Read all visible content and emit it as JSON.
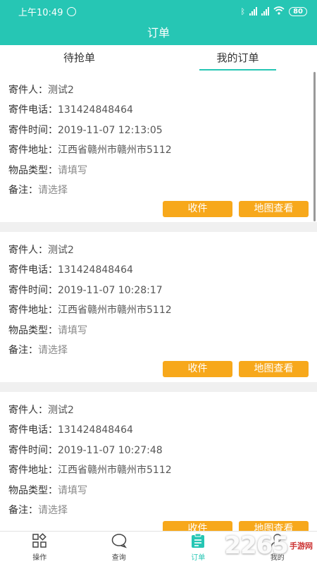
{
  "status_bar": {
    "time": "上午10:49",
    "battery": "80"
  },
  "header": {
    "title": "订单"
  },
  "tabs": [
    {
      "label": "待抢单",
      "active": false
    },
    {
      "label": "我的订单",
      "active": true
    }
  ],
  "field_labels": {
    "sender": "寄件人：",
    "phone": "寄件电话：",
    "time": "寄件时间：",
    "address": "寄件地址：",
    "type": "物品类型：",
    "remark": "备注："
  },
  "orders": [
    {
      "sender": "测试2",
      "phone": "131424848464",
      "time": "2019-11-07 12:13:05",
      "address": "江西省赣州市赣州市5112",
      "type": "请填写",
      "remark": "请选择"
    },
    {
      "sender": "测试2",
      "phone": "131424848464",
      "time": "2019-11-07 10:28:17",
      "address": "江西省赣州市赣州市5112",
      "type": "请填写",
      "remark": "请选择"
    },
    {
      "sender": "测试2",
      "phone": "131424848464",
      "time": "2019-11-07 10:27:48",
      "address": "江西省赣州市赣州市5112",
      "type": "请填写",
      "remark": "请选择"
    }
  ],
  "buttons": {
    "receive": "收件",
    "map": "地图查看"
  },
  "bottom_nav": [
    {
      "label": "操作",
      "icon": "grid-icon"
    },
    {
      "label": "查询",
      "icon": "chat-icon"
    },
    {
      "label": "订单",
      "icon": "clipboard-icon",
      "active": true
    },
    {
      "label": "我的",
      "icon": "user-icon"
    }
  ],
  "watermark": {
    "text": "2265",
    "sub": "手游网"
  },
  "colors": {
    "primary": "#26c6b4",
    "button": "#f7a81b"
  }
}
